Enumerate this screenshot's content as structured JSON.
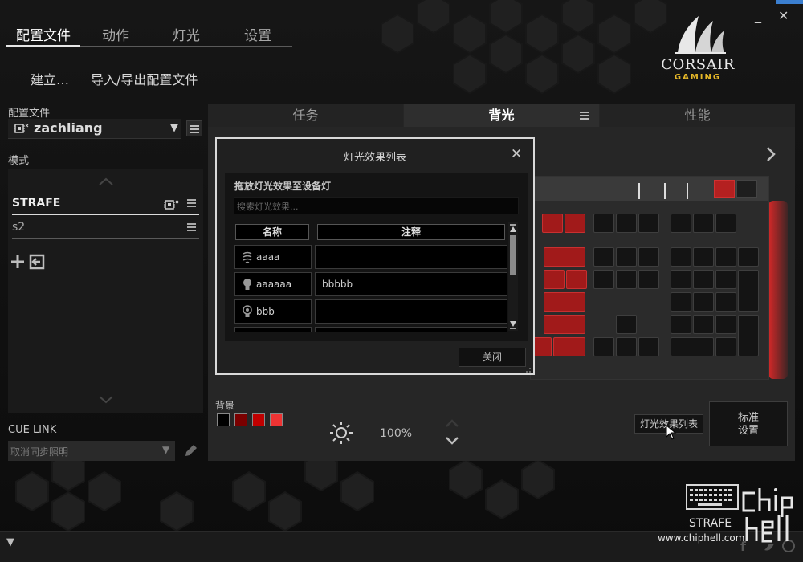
{
  "nav": {
    "tabs": [
      "配置文件",
      "动作",
      "灯光",
      "设置"
    ],
    "active_tab": "配置文件",
    "sub_create": "建立…",
    "sub_import": "导入/导出配置文件"
  },
  "window": {
    "minimize": "_",
    "close": "✕"
  },
  "brand": {
    "name": "CORSAIR",
    "sub": "GAMING"
  },
  "left": {
    "profile_label": "配置文件",
    "profile_name": "zachliang",
    "mode_label": "模式",
    "modes": [
      {
        "label": "STRAFE",
        "active": true
      },
      {
        "label": "s2",
        "active": false
      }
    ],
    "cue_link_label": "CUE LINK",
    "cue_select_value": "取消同步照明"
  },
  "main": {
    "tabs": [
      "任务",
      "背光",
      "性能"
    ],
    "active_tab": "背光",
    "background_label": "背景",
    "swatches": [
      "#000000",
      "#7a0000",
      "#c00000",
      "#ee3333"
    ],
    "brightness": "100%",
    "effects_list_button": "灯光效果列表",
    "standard_settings_line1": "标准",
    "standard_settings_line2": "设置"
  },
  "dialog": {
    "title": "灯光效果列表",
    "instruction": "拖放灯光效果至设备灯",
    "search_placeholder": "搜索灯光效果...",
    "col_name": "名称",
    "col_note": "注释",
    "rows": [
      {
        "icon": "wave-icon",
        "name": "aaaa",
        "note": ""
      },
      {
        "icon": "bulb-icon",
        "name": "aaaaaa",
        "note": "bbbbb"
      },
      {
        "icon": "lamp-icon",
        "name": "bbb",
        "note": ""
      }
    ],
    "close_button": "关闭"
  },
  "device": {
    "name": "STRAFE"
  },
  "watermark": {
    "url": "www.chiphell.com",
    "logo": "chip hell"
  },
  "colors": {
    "accent_red": "#c82020",
    "logo_gold": "#e7b928"
  }
}
